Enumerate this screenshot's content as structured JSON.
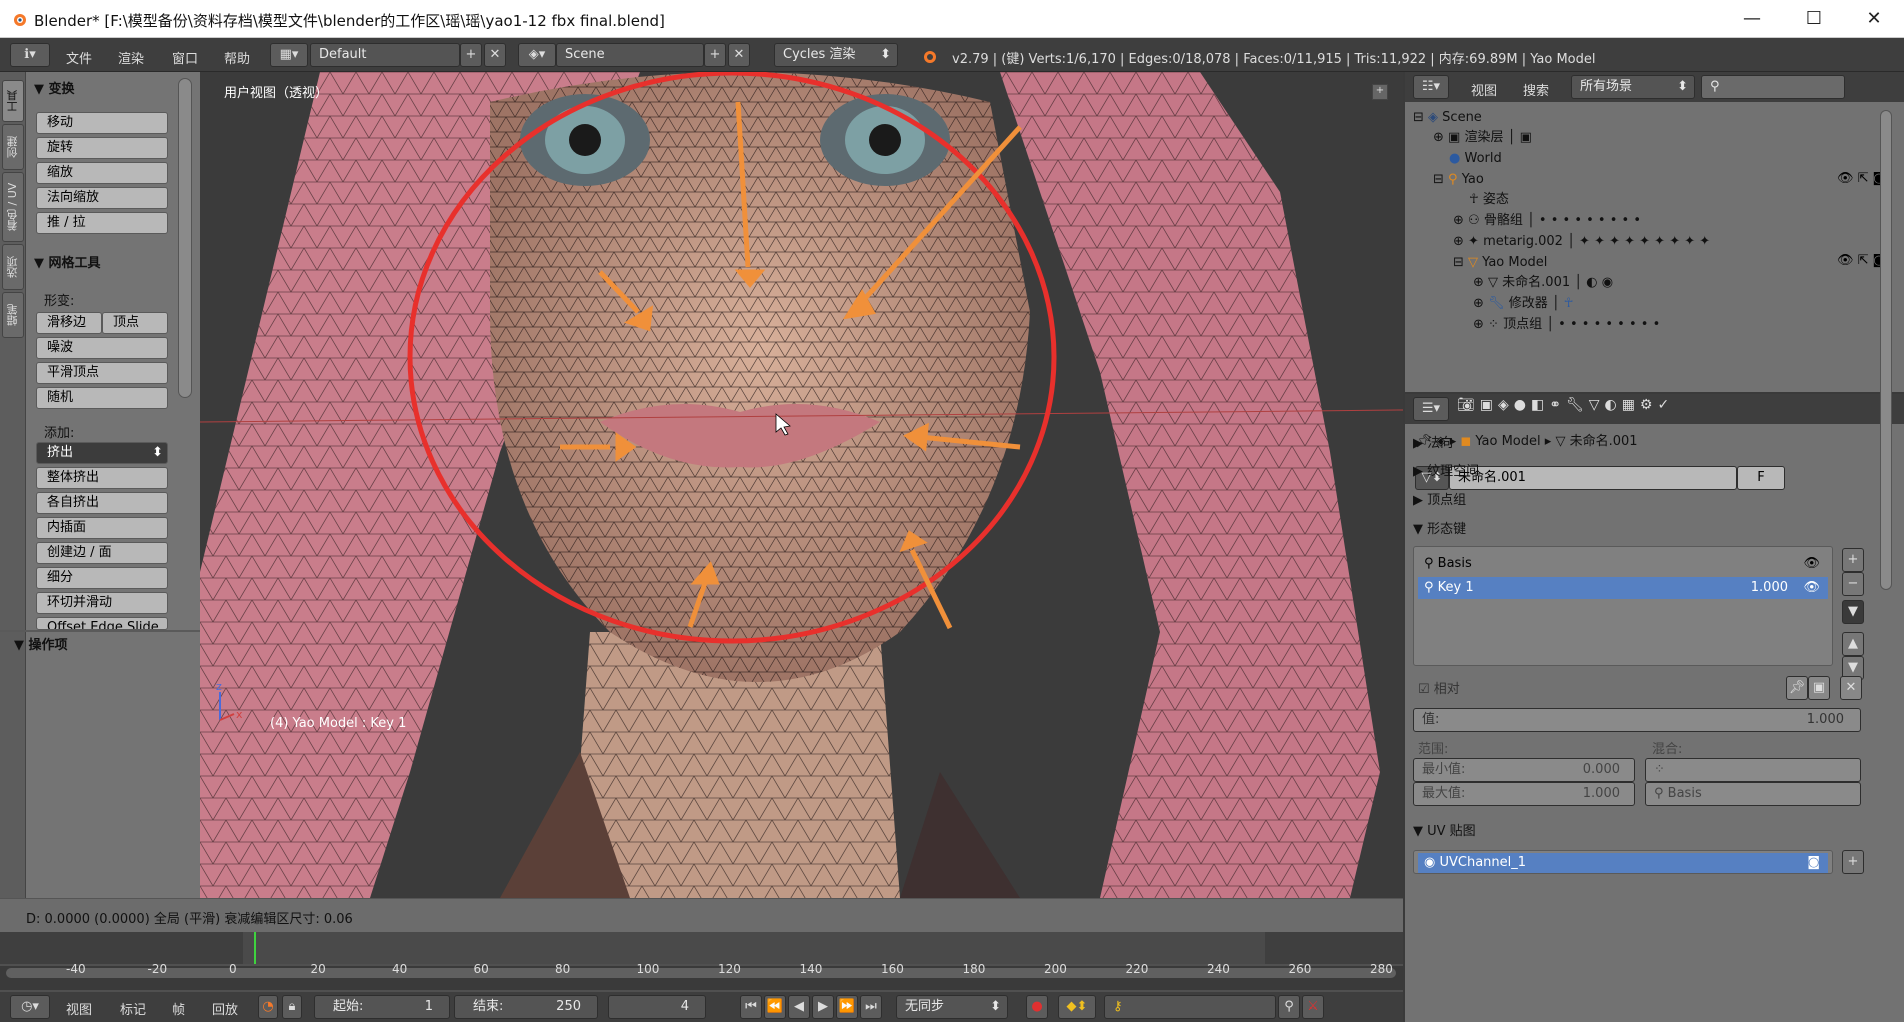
{
  "window": {
    "title": "Blender* [F:\\模型备份\\资料存档\\模型文件\\blender的工作区\\瑶\\瑶\\yao1-12 fbx final.blend]",
    "minimize": "—",
    "maximize": "☐",
    "close": "✕"
  },
  "infobar": {
    "menus": [
      "文件",
      "渲染",
      "窗口",
      "帮助"
    ],
    "layout": "Default",
    "scene": "Scene",
    "engine": "Cycles 渲染",
    "stats": "v2.79 | (键) Verts:1/6,170 | Edges:0/18,078 | Faces:0/11,915 | Tris:11,922 | 内存:69.89M | Yao Model"
  },
  "toolshelf": {
    "tabs": [
      "工具",
      "创建",
      "着色 / UV",
      "选项",
      "蜡笔"
    ],
    "transform_header": "变换",
    "transform_buttons": [
      "移动",
      "旋转",
      "缩放",
      "法向缩放",
      "推 / 拉"
    ],
    "mesh_tools_header": "网格工具",
    "deform_label": "形变:",
    "slide_edge": "滑移边",
    "vertex": "顶点",
    "noise": "噪波",
    "smooth_vertex": "平滑顶点",
    "random": "随机",
    "add_label": "添加:",
    "extrude": "挤出",
    "add_buttons": [
      "整体挤出",
      "各自挤出",
      "内插面",
      "创建边 / 面",
      "细分",
      "环切并滑动",
      "Offset Edge Slide"
    ],
    "operator_header": "操作项"
  },
  "viewport": {
    "view_label": "用户视图（透视）",
    "object_label": "(4) Yao Model : Key 1",
    "status": "D: 0.0000 (0.0000) 全局 (平滑) 衰减编辑区尺寸: 0.06",
    "axis_x": "x",
    "axis_z": "z"
  },
  "timeline": {
    "ticks": [
      "-40",
      "-20",
      "0",
      "20",
      "40",
      "60",
      "80",
      "100",
      "120",
      "140",
      "160",
      "180",
      "200",
      "220",
      "240",
      "260",
      "280"
    ],
    "menus": [
      "视图",
      "标记",
      "帧",
      "回放"
    ],
    "start_label": "起始:",
    "start": "1",
    "end_label": "结束:",
    "end": "250",
    "current": "4",
    "sync": "无同步"
  },
  "outliner": {
    "menus": [
      "视图",
      "搜索"
    ],
    "scene_filter": "所有场景",
    "items": [
      "Scene",
      "渲染层",
      "World",
      "Yao",
      "姿态",
      "骨骼组",
      "metarig.002",
      "Yao Model",
      "未命名.001",
      "修改器",
      "顶点组"
    ]
  },
  "properties": {
    "breadcrumb_object": "Yao Model",
    "breadcrumb_mesh": "未命名.001",
    "mesh_name": "未命名.001",
    "fake_user": "F",
    "sections": [
      "法向",
      "纹理空间",
      "顶点组",
      "形态键"
    ],
    "shape_keys": [
      {
        "name": "Basis",
        "value": ""
      },
      {
        "name": "Key 1",
        "value": "1.000"
      }
    ],
    "relative_label": "相对",
    "value_label": "值:",
    "value": "1.000",
    "range_label": "范围:",
    "blend_label": "混合:",
    "min_label": "最小值:",
    "min": "0.000",
    "max_label": "最大值:",
    "max": "1.000",
    "blend_target": "Basis",
    "uv_section": "UV 贴图",
    "uv_channel": "UVChannel_1"
  }
}
